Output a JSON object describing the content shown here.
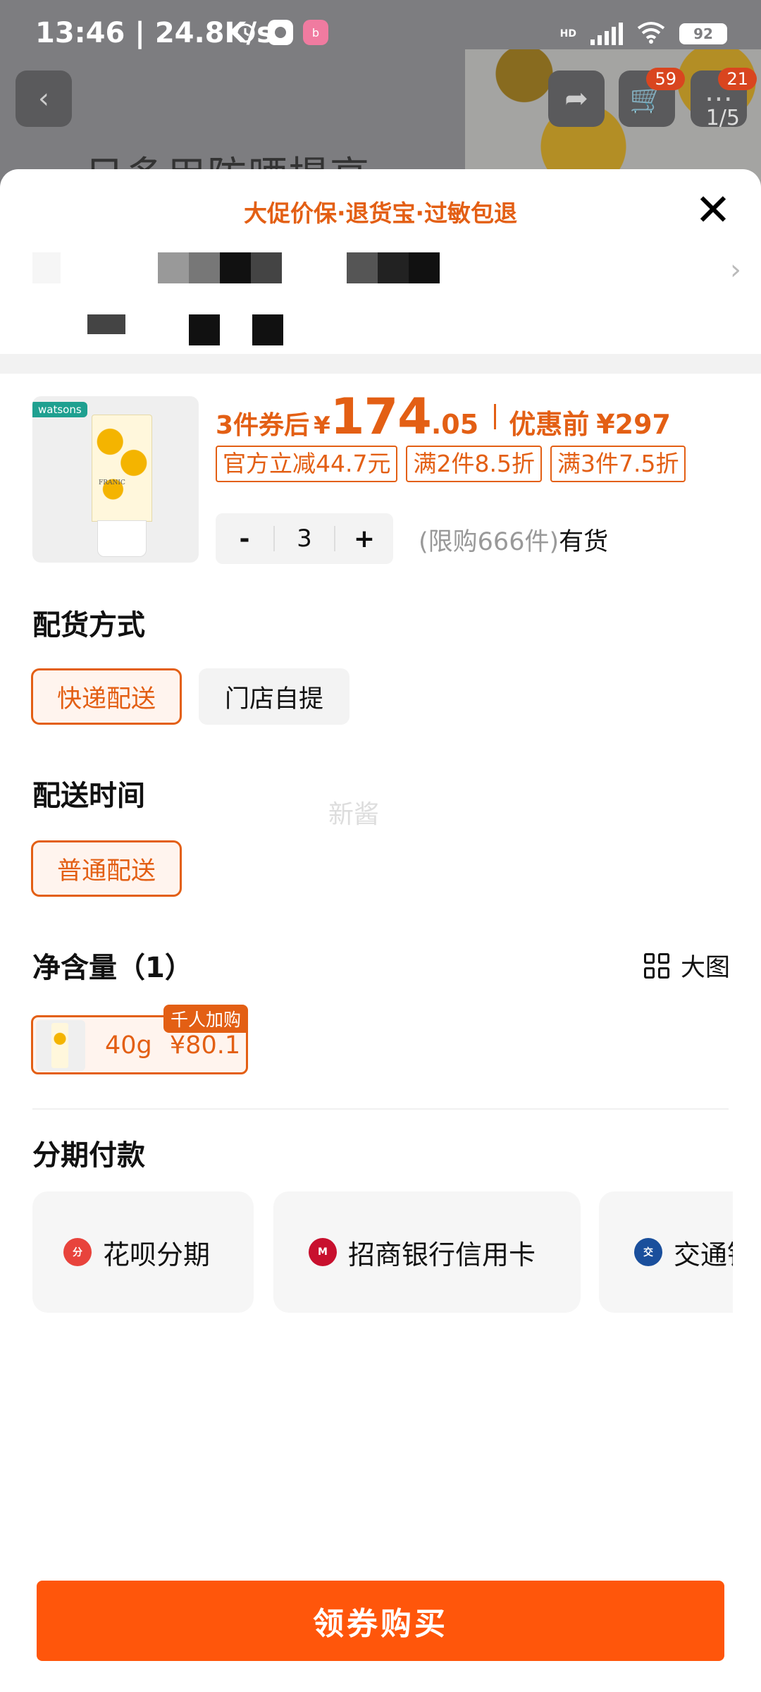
{
  "status_bar": {
    "time": "13:46",
    "speed": "24.8K/s",
    "battery": "92",
    "network": "HD"
  },
  "background": {
    "title": "日多用防晒提高",
    "cart_badge": "59",
    "more_badge": "21",
    "pager": "1/5"
  },
  "sheet": {
    "promo_banner": "大促价保·退货宝·过敏包退"
  },
  "product": {
    "store_tag": "watsons",
    "tube_label": "FRANIC",
    "price_prefix": "3件券后",
    "currency": "¥",
    "price_int": "174",
    "price_dec": ".05",
    "original_label": "优惠前",
    "original_price": "¥297",
    "tags": [
      "官方立减44.7元",
      "满2件8.5折",
      "满3件7.5折"
    ],
    "quantity": "3",
    "minus": "-",
    "plus": "+",
    "limit": "(限购666件)",
    "stock": "有货"
  },
  "delivery_method": {
    "title": "配货方式",
    "options": [
      "快递配送",
      "门店自提"
    ],
    "selected": "快递配送"
  },
  "delivery_time": {
    "title": "配送时间",
    "options": [
      "普通配送"
    ],
    "watermark": "新酱"
  },
  "net_content": {
    "title": "净含量（1）",
    "big_view": "大图",
    "spec": {
      "size": "40g",
      "price": "¥80.1",
      "badge": "千人加购"
    }
  },
  "installment": {
    "title": "分期付款",
    "options": [
      {
        "label": "花呗分期",
        "icon": "huabei-icon",
        "color": "#e8433c"
      },
      {
        "label": "招商银行信用卡",
        "icon": "cmb-icon",
        "color": "#c8102e"
      },
      {
        "label": "交通银行信用卡",
        "icon": "bocom-icon",
        "color": "#1a4f9c"
      }
    ]
  },
  "cta": {
    "label": "领券购买",
    "color": "#ff560b"
  },
  "colors": {
    "accent": "#e35f14"
  }
}
